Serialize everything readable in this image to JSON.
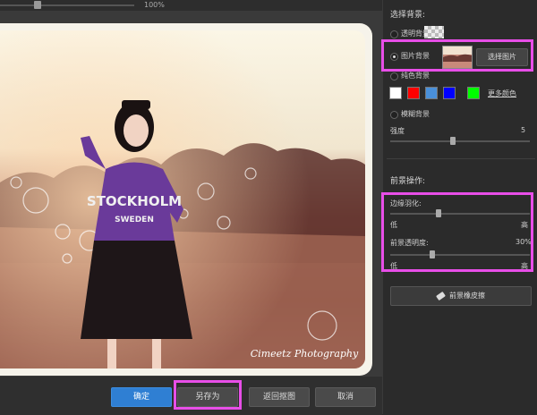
{
  "zoom": {
    "value_label": "100%"
  },
  "background": {
    "section_title": "选择背景:",
    "options": [
      {
        "label": "透明背景",
        "selected": false
      },
      {
        "label": "图片背景",
        "selected": true
      },
      {
        "label": "纯色背景",
        "selected": false
      },
      {
        "label": "模糊背景",
        "selected": false
      }
    ],
    "choose_image_label": "选择图片",
    "solid_colors": [
      "#ffffff",
      "#ff0000",
      "#4a90d9",
      "#0000ff",
      "#00ff00"
    ],
    "more_colors_label": "更多颜色",
    "blur_strength": {
      "label": "强度",
      "value": "5"
    }
  },
  "foreground": {
    "section_title": "前景操作:",
    "feather": {
      "label": "边缘羽化:",
      "min_label": "低",
      "max_label": "高"
    },
    "opacity": {
      "label": "前景透明度:",
      "value": "30%",
      "min_label": "低",
      "max_label": "高"
    },
    "eraser_label": "前景橡皮擦"
  },
  "actions": {
    "ok": "确定",
    "save_as": "另存为",
    "back": "返回抠图",
    "cancel": "取消"
  },
  "photo": {
    "shirt_text_top": "STOCKHOLM",
    "shirt_text_bottom": "SWEDEN",
    "watermark": "Cimeetz Photography"
  }
}
